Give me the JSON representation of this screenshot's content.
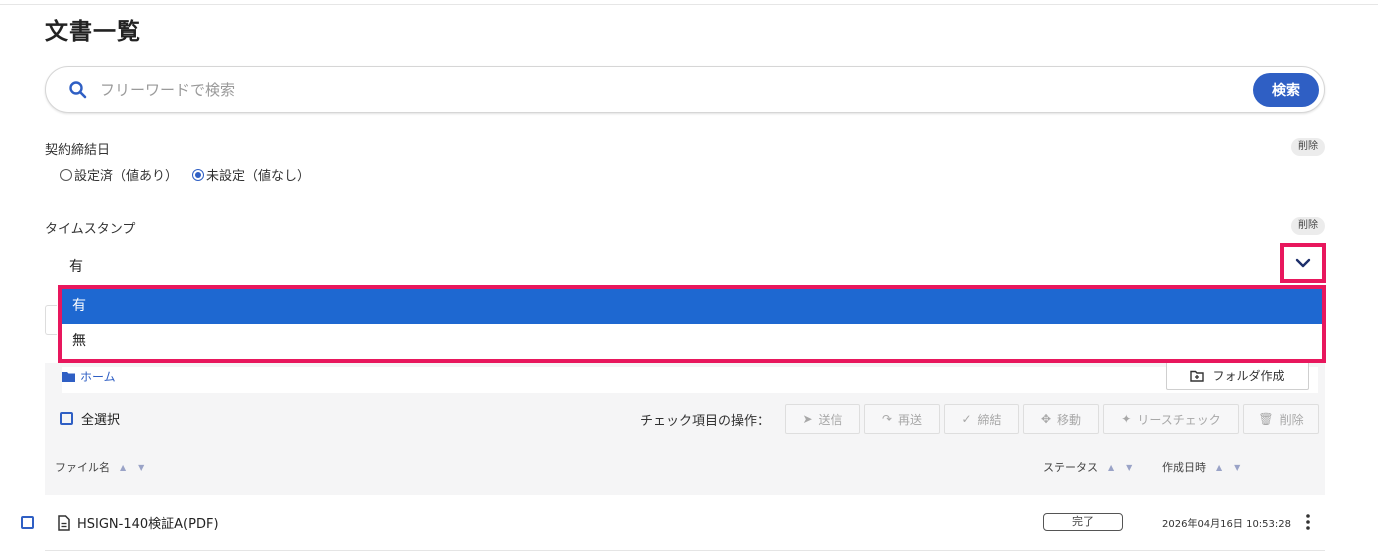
{
  "page": {
    "title": "文書一覧"
  },
  "search": {
    "placeholder": "フリーワードで検索",
    "button_label": "検索"
  },
  "filters": {
    "contract_date": {
      "label": "契約締結日",
      "delete_label": "削除",
      "options": [
        "設定済（値あり）",
        "未設定（値なし）"
      ],
      "selected": "未設定（値なし）"
    },
    "timestamp": {
      "label": "タイムスタンプ",
      "delete_label": "削除",
      "value": "有",
      "options": [
        "有",
        "無"
      ],
      "selected": "有"
    }
  },
  "breadcrumb": {
    "home": "ホーム"
  },
  "toolbar": {
    "folder_create": "フォルダ作成",
    "select_all": "全選択",
    "ops_label": "チェック項目の操作：",
    "actions": [
      "送信",
      "再送",
      "締結",
      "移動",
      "リースチェック",
      "削除"
    ]
  },
  "table": {
    "columns": {
      "filename": "ファイル名",
      "status": "ステータス",
      "created": "作成日時"
    },
    "rows": [
      {
        "name": "HSIGN-140検証A(PDF)",
        "status": "完了",
        "created": "2026年04月16日 10:53:28"
      }
    ]
  },
  "colors": {
    "accent": "#2f5fc4",
    "highlight": "#e8175d",
    "selected_option": "#1e68d1"
  }
}
